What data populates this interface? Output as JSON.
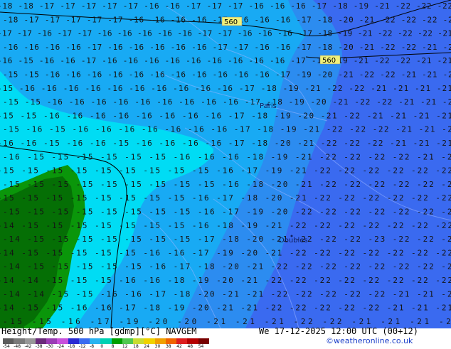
{
  "footer": {
    "title_left": "Height/Temp. 500 hPa [gdmp][°C] NAVGEM",
    "title_right": "We 17-12-2025 12:00 UTC (00+12)",
    "credit": "©weatheronline.co.uk",
    "scale_ticks": [
      "-54",
      "-48",
      "-42",
      "-38",
      "-30",
      "-24",
      "-18",
      "-12",
      "-8",
      "0",
      "8",
      "12",
      "18",
      "24",
      "30",
      "38",
      "42",
      "48",
      "54"
    ],
    "scale_colors": [
      "#5c5c5c",
      "#7a7a7a",
      "#989898",
      "#6a2a7a",
      "#9a3cb4",
      "#c850dc",
      "#2a2ad2",
      "#3a6cf0",
      "#28b4f0",
      "#00d2b4",
      "#00a000",
      "#50c850",
      "#c8dc32",
      "#f0d200",
      "#f0a000",
      "#f06400",
      "#dc1e1e",
      "#b40000",
      "#780000"
    ]
  },
  "map": {
    "colors": {
      "zone_minus15": "#00dcf4",
      "zone_minus16_18": "#18aaf4",
      "zone_minus19_21": "#2c8cf0",
      "zone_minus22_24": "#3a6af0",
      "land_dark": "#056f05",
      "land_green": "#0a960a"
    },
    "contour_labels": [
      "560",
      "560"
    ],
    "cities": [
      "Paris",
      "Doubles"
    ],
    "rows": [
      "-18 -18 -17 -17 -17 -17 -17 -16 -16 -17 -17 -17 -16 -16 -16 -17 -18 -19 -21 -22 -22 -22",
      "-18 -17 -17 -17 -17 -17 -16 -16 -16 -16 -17 -16 -16 -16 -17 -18 -20 -21 -22 -22 -22 -21",
      "-17 -17 -16 -17 -17 -16 -16 -16 -16 -16 -17 -17 -16 -16 -16 -17 -18 -19 -21 -22 -22 -22 -21",
      "-16 -16 -16 -16 -17 -16 -16 -16 -16 -16 -17 -17 -16 -16 -17 -18 -20 -21 -22 -22 -21 -21",
      "-16 -15 -16 -16 -17 -16 -16 -16 -16 -16 -16 -16 -16 -16 -17 -18 -19 -21 -22 -22 -21 -21",
      "-15 -15 -16 -16 -16 -16 -16 -16 -16 -16 -16 -16 -16 -17 -19 -20 -21 -22 -22 -21 -21 -21",
      "-15 -16 -16 -16 -16 -16 -16 -16 -16 -16 -16 -17 -18 -19 -21 -22 -22 -21 -21 -21 -21",
      "-15 -15 -16 -16 -16 -16 -16 -16 -16 -16 -16 -17 -18 -19 -20 -21 -22 -22 -21 -21 -21",
      "-15 -15 -16 -16 -16 -16 -16 -16 -16 -16 -17 -18 -19 -20 -21 -22 -21 -21 -21 -21",
      "-15 -16 -15 -16 -16 -16 -16 -16 -16 -16 -17 -18 -19 -21 -22 -22 -22 -21 -21 -21",
      "-16 -16 -15 -16 -16 -15 -16 -16 -16 -16 -17 -18 -20 -21 -22 -22 -22 -21 -21 -21",
      "-16 -15 -15 -15 -15 -15 -15 -16 -16 -16 -18 -19 -21 -22 -22 -22 -22 -21 -21",
      "-15 -15 -15 -15 -15 -15 -15 -15 -15 -16 -17 -19 -21 -22 -22 -22 -22 -22 -22",
      "-15 -15 -15 -15 -15 -15 -15 -15 -15 -16 -18 -20 -21 -22 -22 -22 -22 -22 -21",
      "-15 -15 -15 -15 -15 -15 -15 -15 -16 -17 -18 -20 -21 -22 -22 -22 -22 -22 -22",
      "-15 -15 -15 -15 -15 -15 -15 -15 -16 -17 -19 -20 -22 -22 -22 -22 -22 -22 -21",
      "-14 -15 -15 -15 -15 -15 -15 -15 -16 -18 -19 -21 -22 -22 -22 -22 -22 -22 -22",
      "-14 -15 -15 -15 -15 -15 -15 -15 -17 -18 -20 -21 -22 -22 -22 -23 -22 -22 -22",
      "-14 -15 -15 -15 -15 -15 -16 -16 -17 -19 -20 -21 -22 -22 -22 -22 -22 -22 -22",
      "-14 -15 -15 -15 -15 -15 -16 -17 -18 -20 -21 -22 -22 -22 -22 -22 -22 -22 -21",
      "-14 -14 -15 -15 -15 -16 -16 -18 -19 -20 -21 -22 -22 -22 -22 -22 -22 -22 -22",
      "-14 -14 -15 -15 -16 -16 -17 -18 -20 -21 -21 -22 -22 -22 -22 -22 -21 -21 -21",
      "-14 -15 -15 -16 -16 -17 -18 -19 -20 -21 -21 -22 -22 -22 -22 -22 -21 -21 -21",
      "-15 -15 -16 -17 -19 -20 -20 -21 -21 -21 -22 -22 -21 -21 -21 -21"
    ]
  }
}
